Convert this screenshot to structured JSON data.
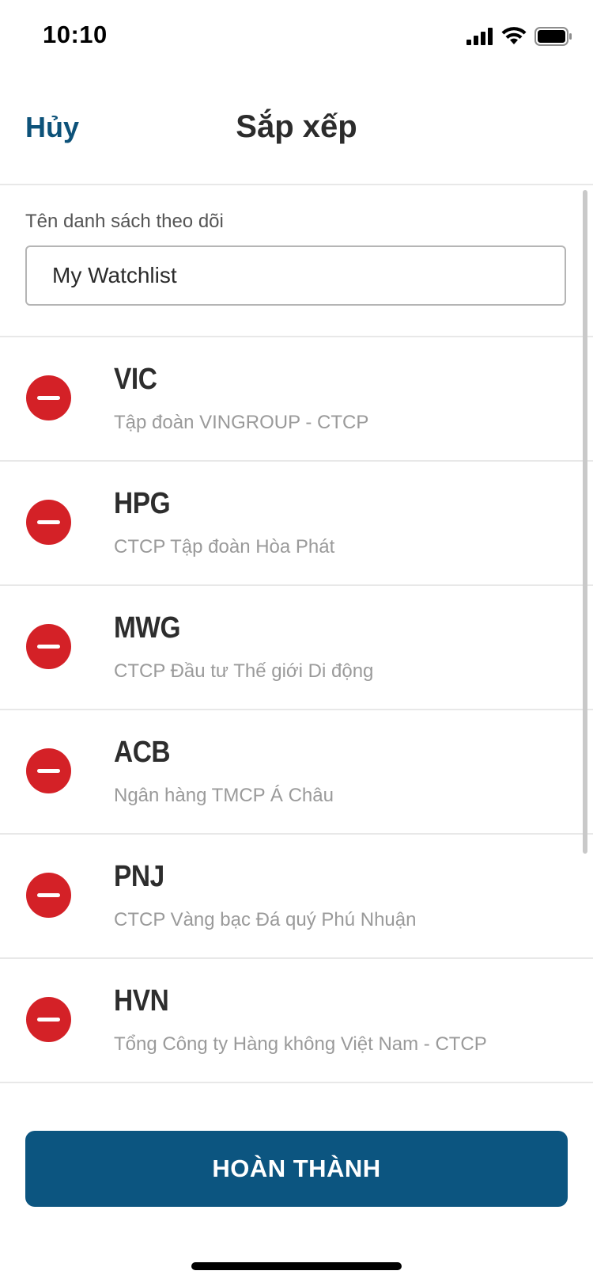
{
  "status_bar": {
    "time": "10:10",
    "icons": [
      "cellular-signal-icon",
      "wifi-icon",
      "battery-icon"
    ]
  },
  "nav": {
    "cancel_label": "Hủy",
    "title": "Sắp xếp"
  },
  "watchlist_name": {
    "label": "Tên danh sách theo dõi",
    "value": "My Watchlist"
  },
  "stocks": [
    {
      "ticker": "VIC",
      "company": "Tập đoàn VINGROUP - CTCP"
    },
    {
      "ticker": "HPG",
      "company": "CTCP Tập đoàn Hòa Phát"
    },
    {
      "ticker": "MWG",
      "company": "CTCP Đầu tư Thế giới Di động"
    },
    {
      "ticker": "ACB",
      "company": "Ngân hàng TMCP Á Châu"
    },
    {
      "ticker": "PNJ",
      "company": "CTCP Vàng bạc Đá quý Phú Nhuận"
    },
    {
      "ticker": "HVN",
      "company": "Tổng Công ty Hàng không Việt Nam - CTCP"
    }
  ],
  "done_label": "HOÀN THÀNH",
  "colors": {
    "accent": "#0c5580",
    "remove": "#d42127",
    "divider": "#e8e8e8"
  }
}
